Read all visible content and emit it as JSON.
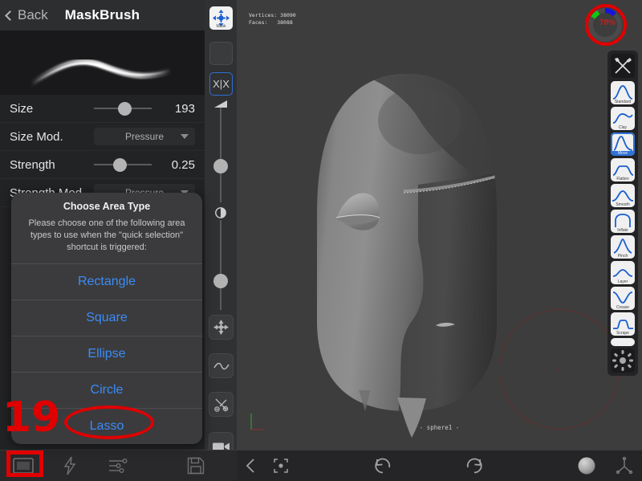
{
  "app": {
    "panel_title": "MaskBrush",
    "back_label": "Back"
  },
  "brush_properties": [
    {
      "label": "Size",
      "type": "slider",
      "value": "193",
      "knob_pct": 42
    },
    {
      "label": "Size Mod.",
      "type": "dropdown",
      "value": "Pressure"
    },
    {
      "label": "Strength",
      "type": "slider",
      "value": "0.25",
      "knob_pct": 33
    },
    {
      "label": "Strength Mod.",
      "type": "dropdown",
      "value": "Pressure"
    }
  ],
  "dialog": {
    "title": "Choose Area Type",
    "message": "Please choose one of the following area types to use when the \"quick selection\" shortcut is triggered:",
    "options": [
      {
        "label": "Rectangle"
      },
      {
        "label": "Square"
      },
      {
        "label": "Ellipse"
      },
      {
        "label": "Circle"
      },
      {
        "label": "Lasso"
      }
    ]
  },
  "mid_toolbar": {
    "mask_label": "Mask",
    "symmetry_label": "X|X",
    "items": [
      {
        "name": "mask-tool",
        "label": "Mask"
      },
      {
        "name": "empty-tool",
        "label": ""
      },
      {
        "name": "symmetry-tool",
        "label": "X|X"
      },
      {
        "name": "size-slider",
        "label": ""
      },
      {
        "name": "opacity-slider",
        "label": ""
      },
      {
        "name": "move-gizmo",
        "label": ""
      },
      {
        "name": "curve-tool",
        "label": ""
      },
      {
        "name": "scissors-tool",
        "label": ""
      },
      {
        "name": "camera-tool",
        "label": ""
      }
    ]
  },
  "viewport": {
    "stats_vertices_label": "Vertices:",
    "stats_vertices_value": "38090",
    "stats_faces_label": "Faces:",
    "stats_faces_value": "38088",
    "object_label": "- sphere1 -"
  },
  "brush_rack": {
    "brushes": [
      {
        "label": "Standard",
        "selected": false
      },
      {
        "label": "Clay",
        "selected": false
      },
      {
        "label": "Move",
        "selected": true
      },
      {
        "label": "Flatten",
        "selected": false
      },
      {
        "label": "Smooth",
        "selected": false
      },
      {
        "label": "Inflate",
        "selected": false
      },
      {
        "label": "Pinch",
        "selected": false
      },
      {
        "label": "Layer",
        "selected": false
      },
      {
        "label": "Crease",
        "selected": false
      },
      {
        "label": "Scrape",
        "selected": false
      }
    ]
  },
  "orbit_widget": {
    "percent_text": "78%"
  },
  "bottom_bar_left": {
    "items": [
      {
        "name": "area-type-button",
        "icon": "rectangle-icon"
      },
      {
        "name": "lightning-button",
        "icon": "lightning-icon"
      },
      {
        "name": "settings-button",
        "icon": "sliders-icon"
      },
      {
        "name": "save-button",
        "icon": "floppy-disk-icon"
      }
    ]
  },
  "bottom_bar_right": {
    "items": [
      {
        "name": "back-nav-button",
        "icon": "chevron-left-icon"
      },
      {
        "name": "focus-button",
        "icon": "focus-target-icon"
      },
      {
        "name": "undo-button",
        "icon": "undo-arrow-icon"
      },
      {
        "name": "redo-button",
        "icon": "redo-arrow-icon"
      },
      {
        "name": "material-button",
        "icon": "sphere-material-icon"
      },
      {
        "name": "axis-button",
        "icon": "axis-gizmo-icon"
      }
    ]
  },
  "annotations": {
    "step_number": "19"
  },
  "colors": {
    "accent_blue": "#3b8cf7",
    "annotation_red": "#e00000",
    "panel_bg": "#222325",
    "viewport_bg": "#3d3d3d"
  }
}
